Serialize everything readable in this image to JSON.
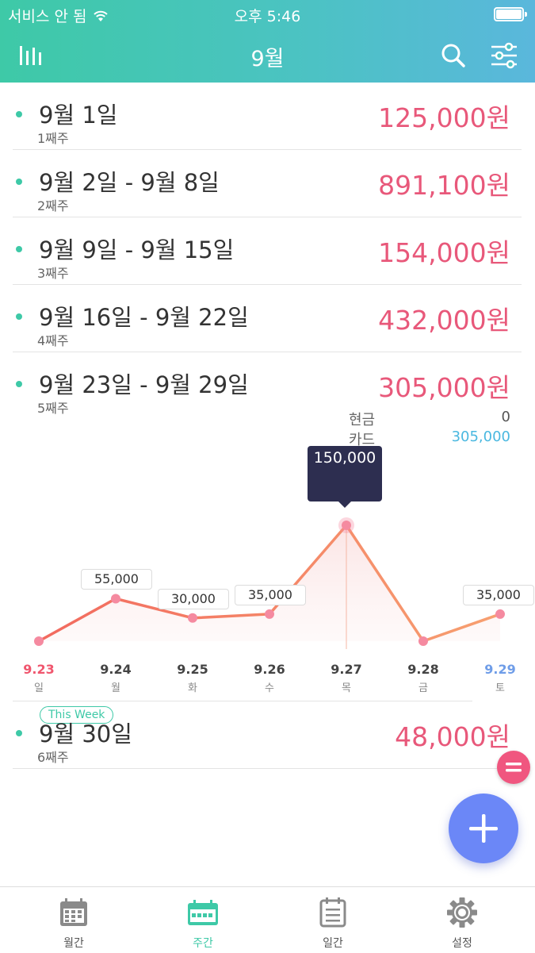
{
  "status_bar": {
    "carrier": "서비스 안 됨",
    "time": "오후 5:46"
  },
  "nav": {
    "title": "9월",
    "left_icon": "bar-chart-icon",
    "search_icon": "search-icon",
    "filter_icon": "filter-sliders-icon"
  },
  "weeks": [
    {
      "range": "9월 1일",
      "week": "1째주",
      "amount": "125,000원"
    },
    {
      "range": "9월 2일 - 9월 8일",
      "week": "2째주",
      "amount": "891,100원"
    },
    {
      "range": "9월 9일 - 9월 15일",
      "week": "3째주",
      "amount": "154,000원"
    },
    {
      "range": "9월 16일 - 9월 22일",
      "week": "4째주",
      "amount": "432,000원"
    },
    {
      "range": "9월 23일 - 9월 29일",
      "week": "5째주",
      "amount": "305,000원"
    },
    {
      "range": "9월 30일",
      "week": "6째주",
      "amount": "48,000원",
      "badge": "This Week"
    }
  ],
  "payment": {
    "cash_label": "현금",
    "cash_value": "0",
    "card_label": "카드",
    "card_value": "305,000",
    "card_color": "#4ab8e0"
  },
  "chart_data": {
    "type": "line",
    "categories": [
      "9.23",
      "9.24",
      "9.25",
      "9.26",
      "9.27",
      "9.28",
      "9.29"
    ],
    "days": [
      "일",
      "월",
      "화",
      "수",
      "목",
      "금",
      "토"
    ],
    "values": [
      0,
      55000,
      30000,
      35000,
      150000,
      0,
      35000
    ],
    "labels": [
      "",
      "55,000",
      "30,000",
      "35,000",
      "150,000",
      "",
      "35,000"
    ],
    "highlight_index": 4,
    "ylim": [
      0,
      150000
    ],
    "colors": {
      "line_start": "#f26a5f",
      "line_end": "#f7a070",
      "point": "#f58aa0",
      "sunday": "#f0566e",
      "saturday": "#6f9de8"
    }
  },
  "tabs": [
    {
      "label": "월간",
      "icon": "calendar-month-icon"
    },
    {
      "label": "주간",
      "icon": "calendar-week-icon",
      "active": true
    },
    {
      "label": "일간",
      "icon": "calendar-day-icon"
    },
    {
      "label": "설정",
      "icon": "gear-icon"
    }
  ],
  "colors": {
    "accent": "#3ec9a7",
    "amount": "#e8587a",
    "fab": "#6b87f7",
    "fab_small": "#f0567f"
  }
}
